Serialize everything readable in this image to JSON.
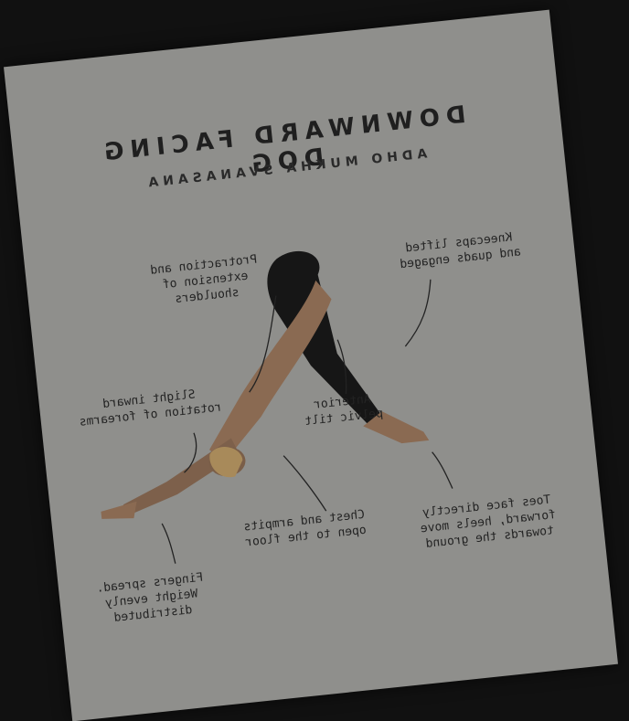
{
  "poster": {
    "title": "DOWNWARD FACING DOG",
    "subtitle": "ADHO MUKHA SVANASANA",
    "annotations": {
      "shoulders": "Protraction and\nextension of\nshoulders",
      "knees": "Kneecaps lifted\nand quads engaged",
      "forearms": "Slight inward\nrotation of forearms",
      "pelvis": "Anterior\npelvic tilt",
      "chest": "Chest and armpits\nopen to the floor",
      "toes": "Toes face directly\nforward, heels move\ntowards the ground",
      "fingers": "Fingers spread.\nWeight evenly\ndistributed"
    }
  },
  "colors": {
    "background": "#111111",
    "paper": "#8f8f8c",
    "skin": "#8a6a52",
    "leggings": "#161616",
    "ink": "#232323"
  }
}
